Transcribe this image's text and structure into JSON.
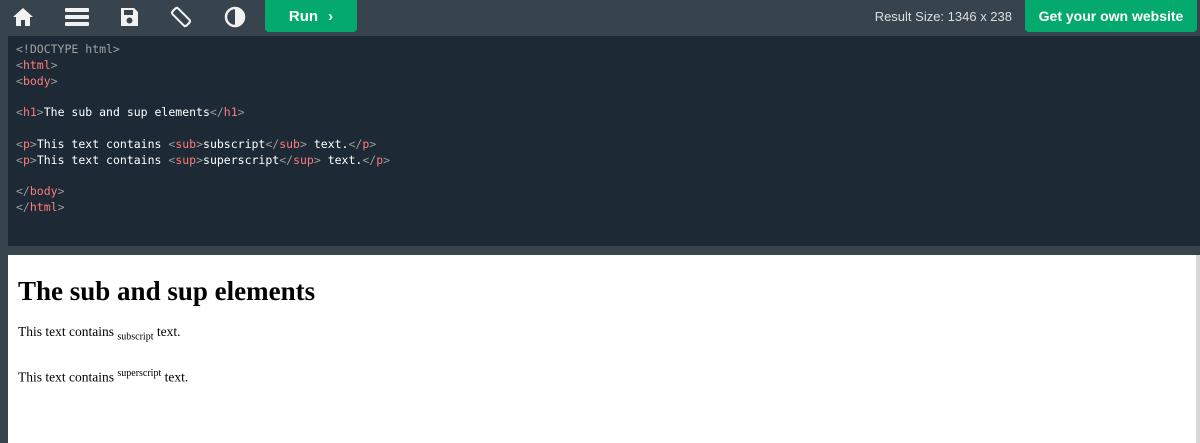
{
  "toolbar": {
    "icons": [
      "home-icon",
      "menu-icon",
      "save-icon",
      "rotate-icon",
      "contrast-icon"
    ],
    "run_label": "Run",
    "run_chevron": "›",
    "result_size": "Result Size: 1346 x 238",
    "get_website_label": "Get your own website"
  },
  "code": {
    "doctype": "<!DOCTYPE html>",
    "html_open": "html",
    "body_open": "body",
    "h1_tag": "h1",
    "h1_text": "The sub and sup elements",
    "p_tag": "p",
    "p1_text_a": "This text contains ",
    "sub_tag": "sub",
    "sub_word": "subscript",
    "sup_tag": "sup",
    "sup_word": "superscript",
    "p_text_end": " text.",
    "body_close": "body",
    "html_close": "html"
  },
  "result": {
    "heading": "The sub and sup elements",
    "p1_prefix": "This text contains ",
    "p1_sub": "subscript",
    "p1_suffix": " text.",
    "p2_prefix": "This text contains ",
    "p2_sup": "superscript",
    "p2_suffix": " text."
  },
  "colors": {
    "toolbar_bg": "#38444d",
    "editor_bg": "#1d2a35",
    "accent_green": "#04aa6d",
    "tag_color": "#ff7a7a"
  }
}
